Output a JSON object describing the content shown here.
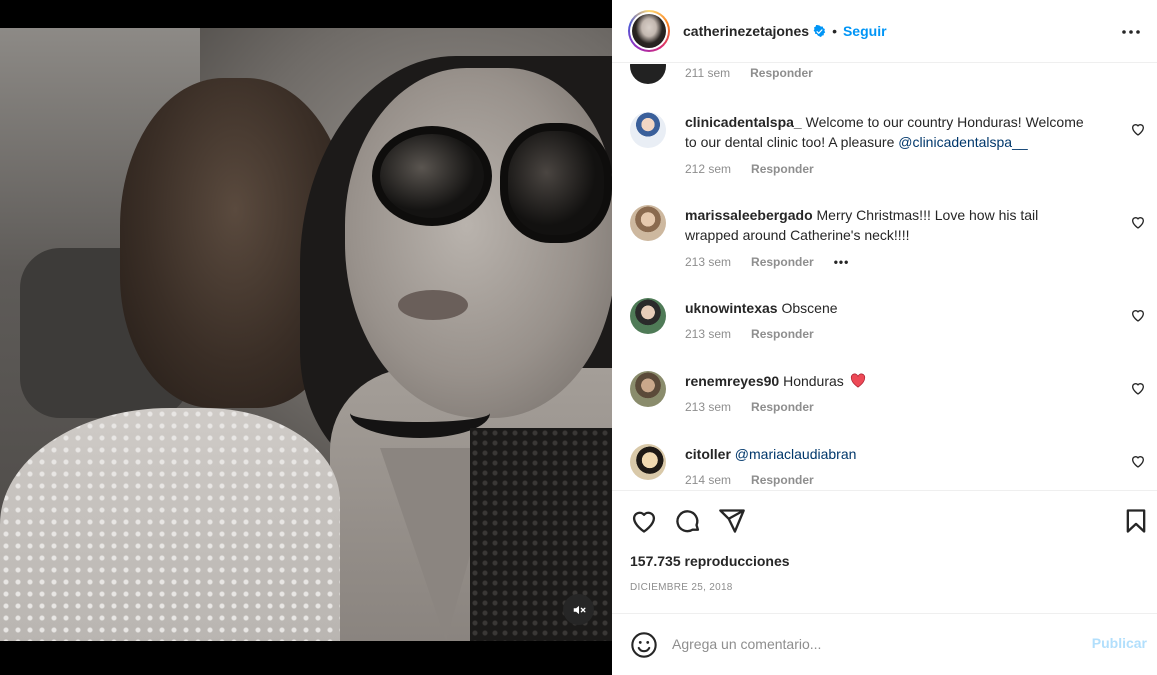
{
  "post": {
    "author": "catherinezetajones",
    "separator": "•",
    "follow_label": "Seguir",
    "views": "157.735 reproducciones",
    "date": "DICIEMBRE 25, 2018"
  },
  "comments": [
    {
      "user": "",
      "text": "",
      "time": "211 sem",
      "reply": "Responder"
    },
    {
      "user": "clinicadentalspa_",
      "text": "Welcome to our country Honduras! Welcome to our dental clinic too! A pleasure ",
      "mention": "@clinicadentalspa__",
      "time": "212 sem",
      "reply": "Responder"
    },
    {
      "user": "marissaleebergado",
      "text": "Merry Christmas!!! Love how his tail wrapped around Catherine's neck!!!!",
      "time": "213 sem",
      "reply": "Responder",
      "more": "•••"
    },
    {
      "user": "uknowintexas",
      "text": "Obscene",
      "time": "213 sem",
      "reply": "Responder"
    },
    {
      "user": "renemreyes90",
      "text": "Honduras",
      "emoji": "red-heart",
      "time": "213 sem",
      "reply": "Responder"
    },
    {
      "user": "citoller",
      "mention": "@mariaclaudiabran",
      "time": "214 sem",
      "reply": "Responder"
    }
  ],
  "composer": {
    "placeholder": "Agrega un comentario...",
    "publish_label": "Publicar"
  },
  "icons": [
    "verified-badge-icon",
    "more-options-icon",
    "heart-icon",
    "comment-icon",
    "share-icon",
    "bookmark-icon",
    "emoji-icon",
    "mute-icon"
  ],
  "colors": {
    "accent": "#0095f6",
    "mention": "#00376b",
    "muted": "#8e8e8e",
    "publish_disabled": "#b2dffc",
    "heart_red": "#ed4956"
  }
}
